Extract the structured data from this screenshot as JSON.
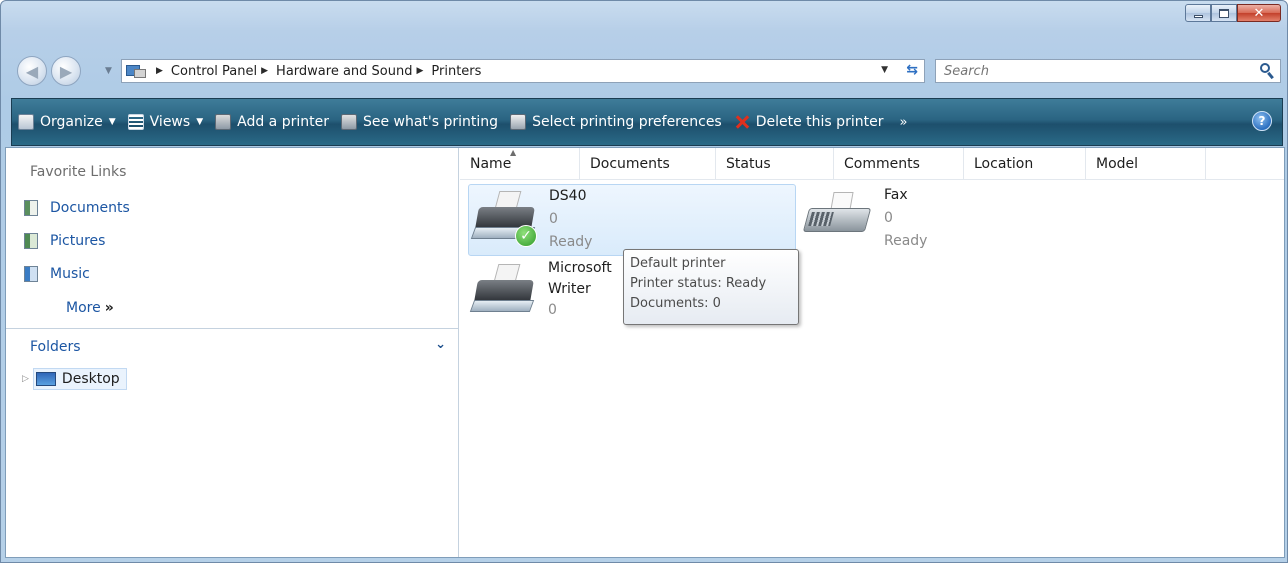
{
  "window": {
    "caption_buttons": {
      "minimize": "minimize-icon",
      "maximize": "maximize-icon",
      "close": "close-icon"
    }
  },
  "nav": {
    "back_icon": "back-arrow-icon",
    "forward_icon": "forward-arrow-icon",
    "breadcrumb": [
      "Control Panel",
      "Hardware and Sound",
      "Printers"
    ],
    "search_placeholder": "Search"
  },
  "toolbar": {
    "organize": "Organize",
    "views": "Views",
    "add_printer": "Add a printer",
    "see_printing": "See what's printing",
    "select_prefs": "Select printing preferences",
    "delete_printer": "Delete this printer",
    "more": "»",
    "help": "?"
  },
  "sidebar": {
    "favorites_title": "Favorite Links",
    "favorites": [
      {
        "label": "Documents",
        "icon": "documents-icon"
      },
      {
        "label": "Pictures",
        "icon": "pictures-icon"
      },
      {
        "label": "Music",
        "icon": "music-icon"
      }
    ],
    "more_label": "More",
    "more_chevron": "»",
    "folders_label": "Folders",
    "tree": [
      {
        "label": "Desktop",
        "icon": "desktop-icon",
        "selected": true
      }
    ]
  },
  "columns": [
    "Name",
    "Documents",
    "Status",
    "Comments",
    "Location",
    "Model"
  ],
  "printers": [
    {
      "name": "DS40",
      "documents": "0",
      "status": "Ready",
      "default": true,
      "icon": "printer-icon",
      "selected": true
    },
    {
      "name": "Fax",
      "documents": "0",
      "status": "Ready",
      "icon": "fax-icon"
    },
    {
      "name_line1": "Microsoft",
      "name_line2": "Writer",
      "documents": "0",
      "icon": "printer-icon"
    }
  ],
  "tooltip": {
    "line1": "Default printer",
    "line2": "Printer status: Ready",
    "line3": "Documents: 0"
  },
  "colors": {
    "command_bar": "#2a6482",
    "link": "#1c56a3",
    "selection_bg": "#d9ebfb",
    "close_button": "#c3402b"
  }
}
